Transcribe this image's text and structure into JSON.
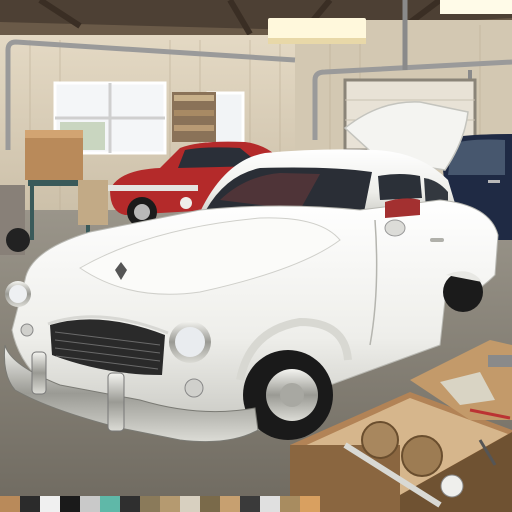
{
  "scene": {
    "palette": {
      "ceiling": "#5a4a3a",
      "wall": "#d9cdb8",
      "floor": "#8a8478",
      "car_white": "#f2f2ef",
      "car_red": "#b42a2a",
      "car_blue": "#1f2a44",
      "chrome": "#c9c9c4",
      "wood": "#a9784a",
      "light": "#fff8dc"
    },
    "swatches": [
      "#b98a5a",
      "#2b2b2b",
      "#f0f0f0",
      "#1a1a1a",
      "#c9c9c9",
      "#5fb8a8",
      "#2f2f2f",
      "#8a7a5a",
      "#b59a70",
      "#d8d0c0",
      "#7a6a4a",
      "#c7a070",
      "#3a3a3a",
      "#e0e0e0",
      "#a88c60",
      "#d9a060"
    ]
  }
}
